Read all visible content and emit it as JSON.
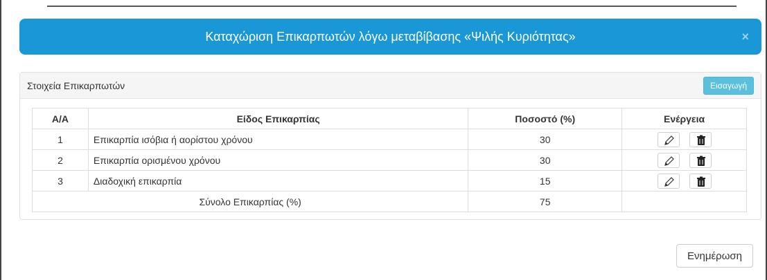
{
  "modal": {
    "title": "Καταχώριση Επικαρπωτών λόγω μεταβίβασης «Ψιλής Κυριότητας»",
    "close_symbol": "×"
  },
  "panel": {
    "heading": "Στοιχεία Επικαρπωτών",
    "insert_label": "Εισαγωγή"
  },
  "table": {
    "headers": {
      "aa": "Α/Α",
      "type": "Είδος Επικαρπίας",
      "percent": "Ποσοστό (%)",
      "action": "Ενέργεια"
    },
    "rows": [
      {
        "aa": "1",
        "type": "Επικαρπία ισόβια ή αορίστου χρόνου",
        "percent": "30"
      },
      {
        "aa": "2",
        "type": "Επικαρπία ορισμένου χρόνου",
        "percent": "30"
      },
      {
        "aa": "3",
        "type": "Διαδοχική επικαρπία",
        "percent": "15"
      }
    ],
    "total": {
      "label": "Σύνολο Επικαρπίας (%)",
      "percent": "75"
    },
    "action_icons": [
      "pencil-icon",
      "trash-icon"
    ]
  },
  "footer": {
    "update_label": "Ενημέρωση"
  },
  "colors": {
    "header_blue": "#1a97d6",
    "insert_button": "#5bc0de"
  }
}
